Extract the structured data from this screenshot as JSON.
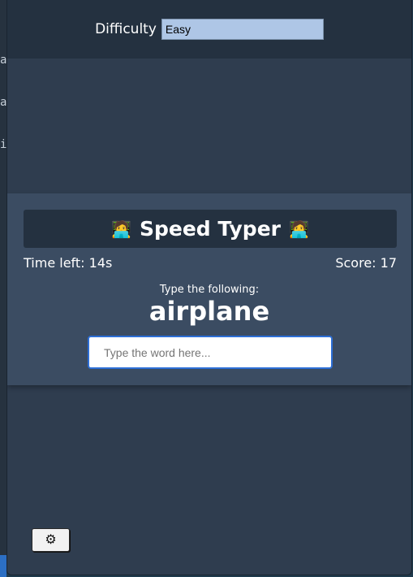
{
  "header": {
    "difficulty_label": "Difficulty",
    "difficulty_selected": "Easy"
  },
  "game": {
    "title": "Speed Typer",
    "title_icon": "technologist-emoji",
    "time_left_label": "Time left:",
    "time_left_value": "14s",
    "score_label": "Score:",
    "score_value": "17",
    "prompt_label": "Type the following:",
    "current_word": "airplane",
    "input_placeholder": "Type the word here..."
  },
  "footer": {
    "settings_icon": "gear-icon"
  },
  "background": {
    "edge_chars": [
      "a",
      "a",
      "i"
    ]
  },
  "colors": {
    "accent_focus": "#2d6fd6",
    "select_bg": "#aec6e6",
    "panel_bg": "#3b4c62",
    "window_bg": "#2f3d4f"
  }
}
